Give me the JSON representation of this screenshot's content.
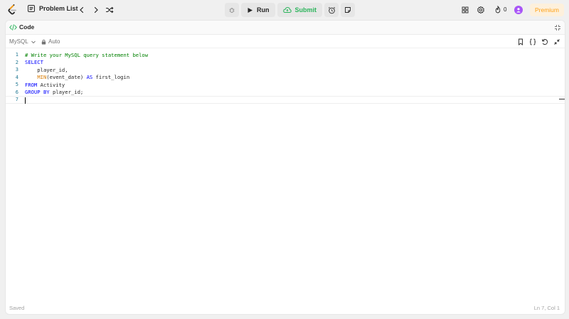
{
  "navbar": {
    "problem_list_label": "Problem List",
    "run_label": "Run",
    "submit_label": "Submit",
    "streak_count": "0",
    "premium_label": "Premium"
  },
  "panel": {
    "tab_label": "Code"
  },
  "toolbar": {
    "language": "MySQL",
    "mode": "Auto"
  },
  "editor": {
    "lines": [
      {
        "num": "1",
        "text": "# Write your MySQL query statement below"
      },
      {
        "num": "2",
        "text": "SELECT"
      },
      {
        "num": "3",
        "text": "    player_id,"
      },
      {
        "num": "4",
        "text": "    MIN(event_date) AS first_login"
      },
      {
        "num": "5",
        "text": "FROM Activity"
      },
      {
        "num": "6",
        "text": "GROUP BY player_id;"
      },
      {
        "num": "7",
        "text": ""
      }
    ]
  },
  "status": {
    "saved": "Saved",
    "cursor_position": "Ln 7, Col 1"
  },
  "colors": {
    "brand": "#ffa116",
    "submit_green": "#2db55d",
    "keyword_blue": "#0000ff",
    "comment_green": "#008000",
    "function_orange": "#d87a00",
    "line_number": "#237893"
  },
  "icons": [
    "logo-icon",
    "list-icon",
    "chevron-left-icon",
    "chevron-right-icon",
    "shuffle-icon",
    "debug-icon",
    "play-icon",
    "cloud-upload-icon",
    "alarm-icon",
    "note-icon",
    "layout-icon",
    "gear-icon",
    "fire-icon",
    "avatar",
    "code-icon",
    "maximize-icon",
    "chevron-down-icon",
    "lock-icon",
    "bookmark-icon",
    "braces-icon",
    "reset-icon",
    "collapse-icon"
  ]
}
